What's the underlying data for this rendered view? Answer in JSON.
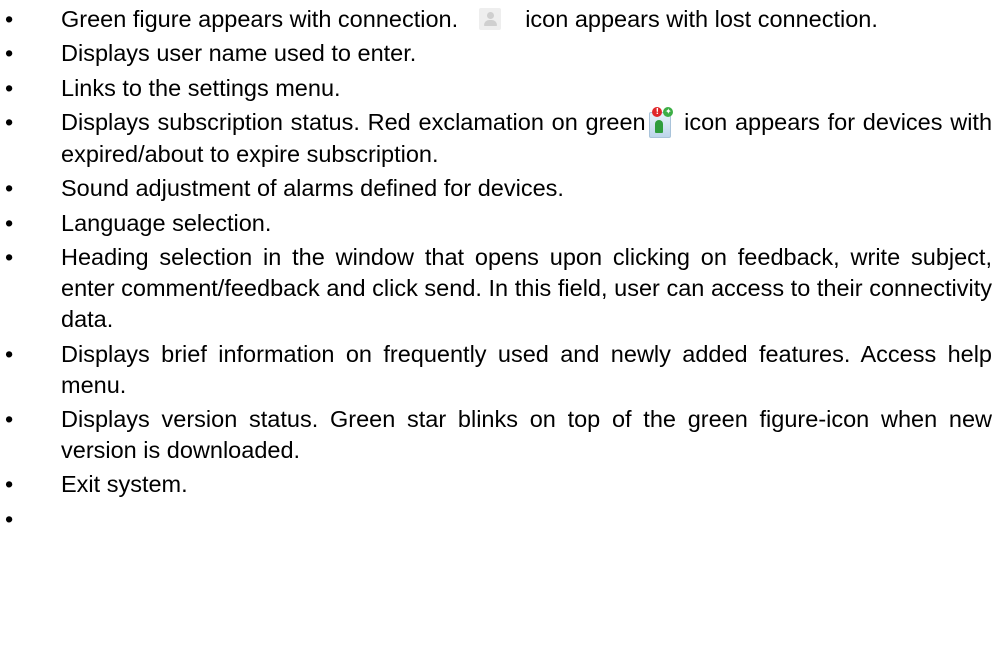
{
  "items": [
    {
      "before": "Green figure appears with connection.",
      "after": "icon appears with lost connection.",
      "icon": "user-offline-icon"
    },
    {
      "text": "Displays user name used to enter."
    },
    {
      "text": "Links to the settings menu."
    },
    {
      "before": "Displays subscription status. Red exclamation on green",
      "after": "icon appears for devices with expired/about to expire subscription.",
      "icon": "subscription-alert-icon"
    },
    {
      "text": "Sound adjustment of alarms defined for devices."
    },
    {
      "text": "Language selection."
    },
    {
      "text": "Heading selection in the window that opens upon clicking on feedback, write subject, enter comment/feedback and click send. In this field, user can access to their connectivity data."
    },
    {
      "text": "Displays brief information on frequently used and newly added features. Access help menu."
    },
    {
      "text": "Displays version status. Green star blinks on top of the green figure-icon when new version is downloaded."
    },
    {
      "text": "Exit system."
    },
    {
      "text": ""
    }
  ]
}
